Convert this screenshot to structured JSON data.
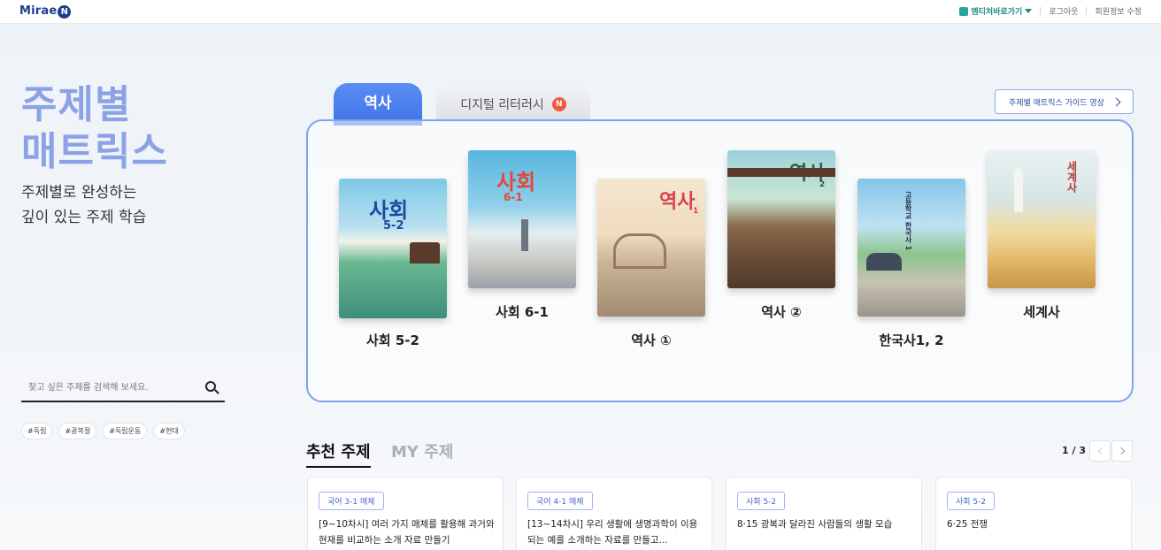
{
  "topbar": {
    "logo": "Mirae",
    "logo_mark": "N",
    "links": [
      "엠티처바로가기",
      "로그아웃",
      "회원정보 수정"
    ]
  },
  "hero": {
    "title_line1": "주제별",
    "title_line2": "매트릭스",
    "sub_line1": "주제별로 완성하는",
    "sub_line2": "깊이 있는 주제 학습"
  },
  "search": {
    "placeholder": "찾고 싶은 주제를 검색해 보세요.",
    "tags": [
      "#독립",
      "#광복절",
      "#독립운동",
      "#현대"
    ]
  },
  "tabs": {
    "active": "역사",
    "inactive": "디지털 리터러시",
    "badge": "N"
  },
  "guide_button": "주제별 매트릭스 가이드 영상",
  "books": [
    {
      "label": "사회 5-2",
      "cover_title": "사회",
      "cover_sub": "5-2"
    },
    {
      "label": "사회 6-1",
      "cover_title": "사회",
      "cover_sub": "6-1"
    },
    {
      "label": "역사 ①",
      "cover_title": "역사",
      "cover_sub": "1"
    },
    {
      "label": "역사 ②",
      "cover_title": "역사",
      "cover_sub": "2"
    },
    {
      "label": "한국사1, 2",
      "cover_title": "고등학교 한국사 1",
      "cover_sub": ""
    },
    {
      "label": "세계사",
      "cover_title": "세계사",
      "cover_sub": ""
    }
  ],
  "colors": {
    "accent": "#3f74e8",
    "hero_title": "#8ba3e6",
    "panel_border": "#7ea3ee",
    "badge": "#f05a3a"
  },
  "recommend": {
    "tab_active": "추천 주제",
    "tab_inactive": "MY 주제",
    "pager": "1 / 3",
    "cards": [
      {
        "chip": "국어 3-1 매체",
        "text": "[9~10차시] 여러 가지 매체를 활용해 과거와 현재를 비교하는 소개 자료 만들기"
      },
      {
        "chip": "국어 4-1 매체",
        "text": "[13~14차시] 우리 생활에 생명과학이 이용되는 예를 소개하는 자료를 만들고..."
      },
      {
        "chip": "사회 5-2",
        "text": "8·15 광복과 달라진 사람들의 생활 모습"
      },
      {
        "chip": "사회 5-2",
        "text": "6·25 전쟁"
      }
    ]
  }
}
